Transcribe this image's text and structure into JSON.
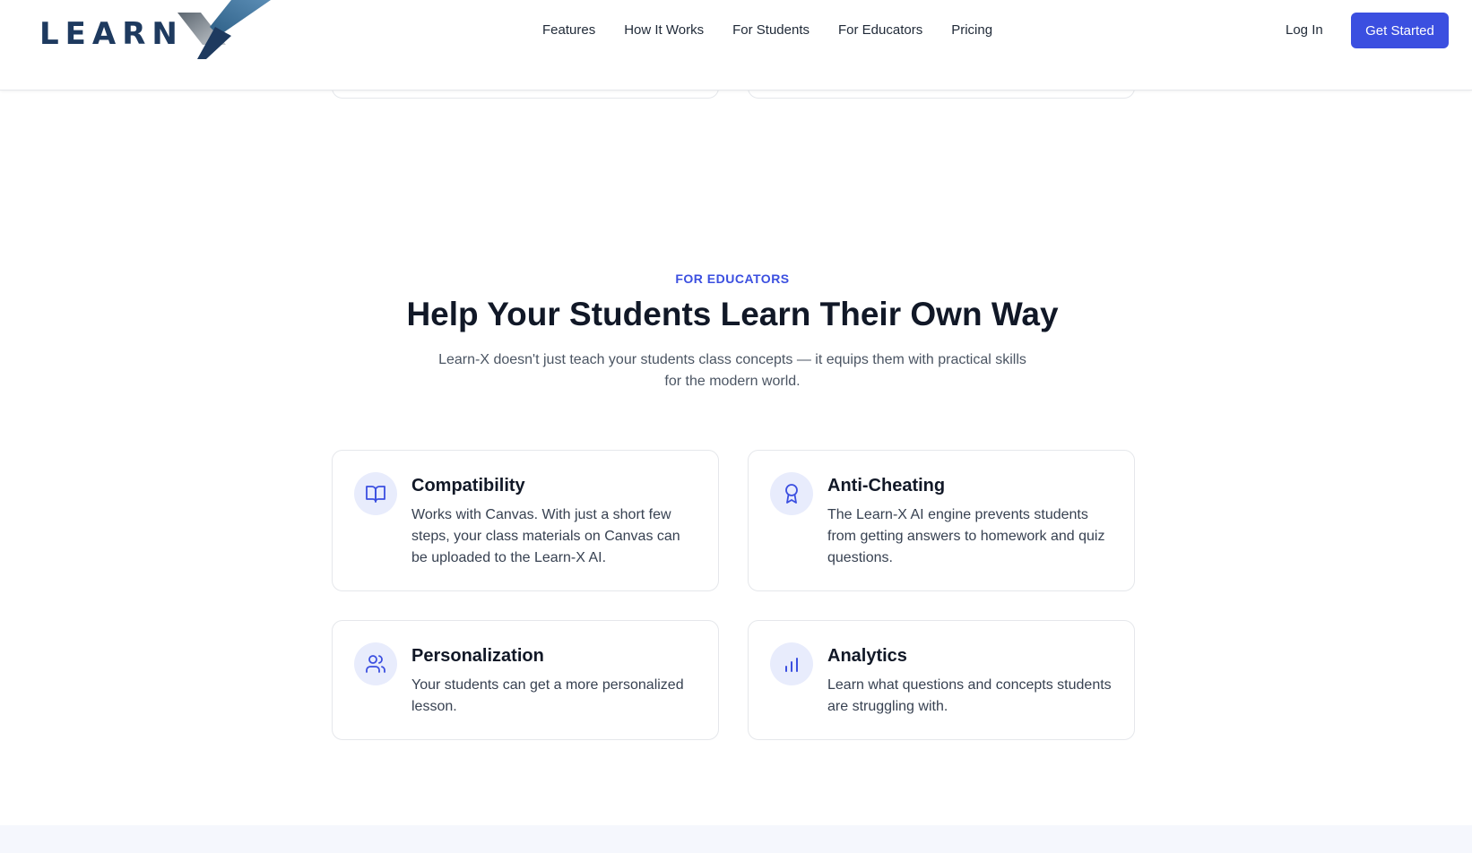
{
  "brand": {
    "logo_text": "LEARN"
  },
  "nav": {
    "items": [
      "Features",
      "How It Works",
      "For Students",
      "For Educators",
      "Pricing"
    ],
    "login": "Log In",
    "cta": "Get Started"
  },
  "section": {
    "eyebrow": "FOR EDUCATORS",
    "title": "Help Your Students Learn Their Own Way",
    "subtitle": "Learn-X doesn't just teach your students class concepts — it equips them with practical skills for the modern world."
  },
  "cards": [
    {
      "icon": "book-open-icon",
      "title": "Compatibility",
      "body": "Works with Canvas. With just a short few steps, your class materials on Canvas can be uploaded to the Learn-X AI."
    },
    {
      "icon": "award-icon",
      "title": "Anti-Cheating",
      "body": "The Learn-X AI engine prevents students from getting answers to homework and quiz questions."
    },
    {
      "icon": "users-icon",
      "title": "Personalization",
      "body": "Your students can get a more personalized lesson."
    },
    {
      "icon": "bar-chart-icon",
      "title": "Analytics",
      "body": "Learn what questions and concepts students are struggling with."
    }
  ],
  "colors": {
    "accent": "#3b4fe0",
    "icon_bg": "#e8ecfc",
    "logo_navy": "#1e3a5f"
  }
}
